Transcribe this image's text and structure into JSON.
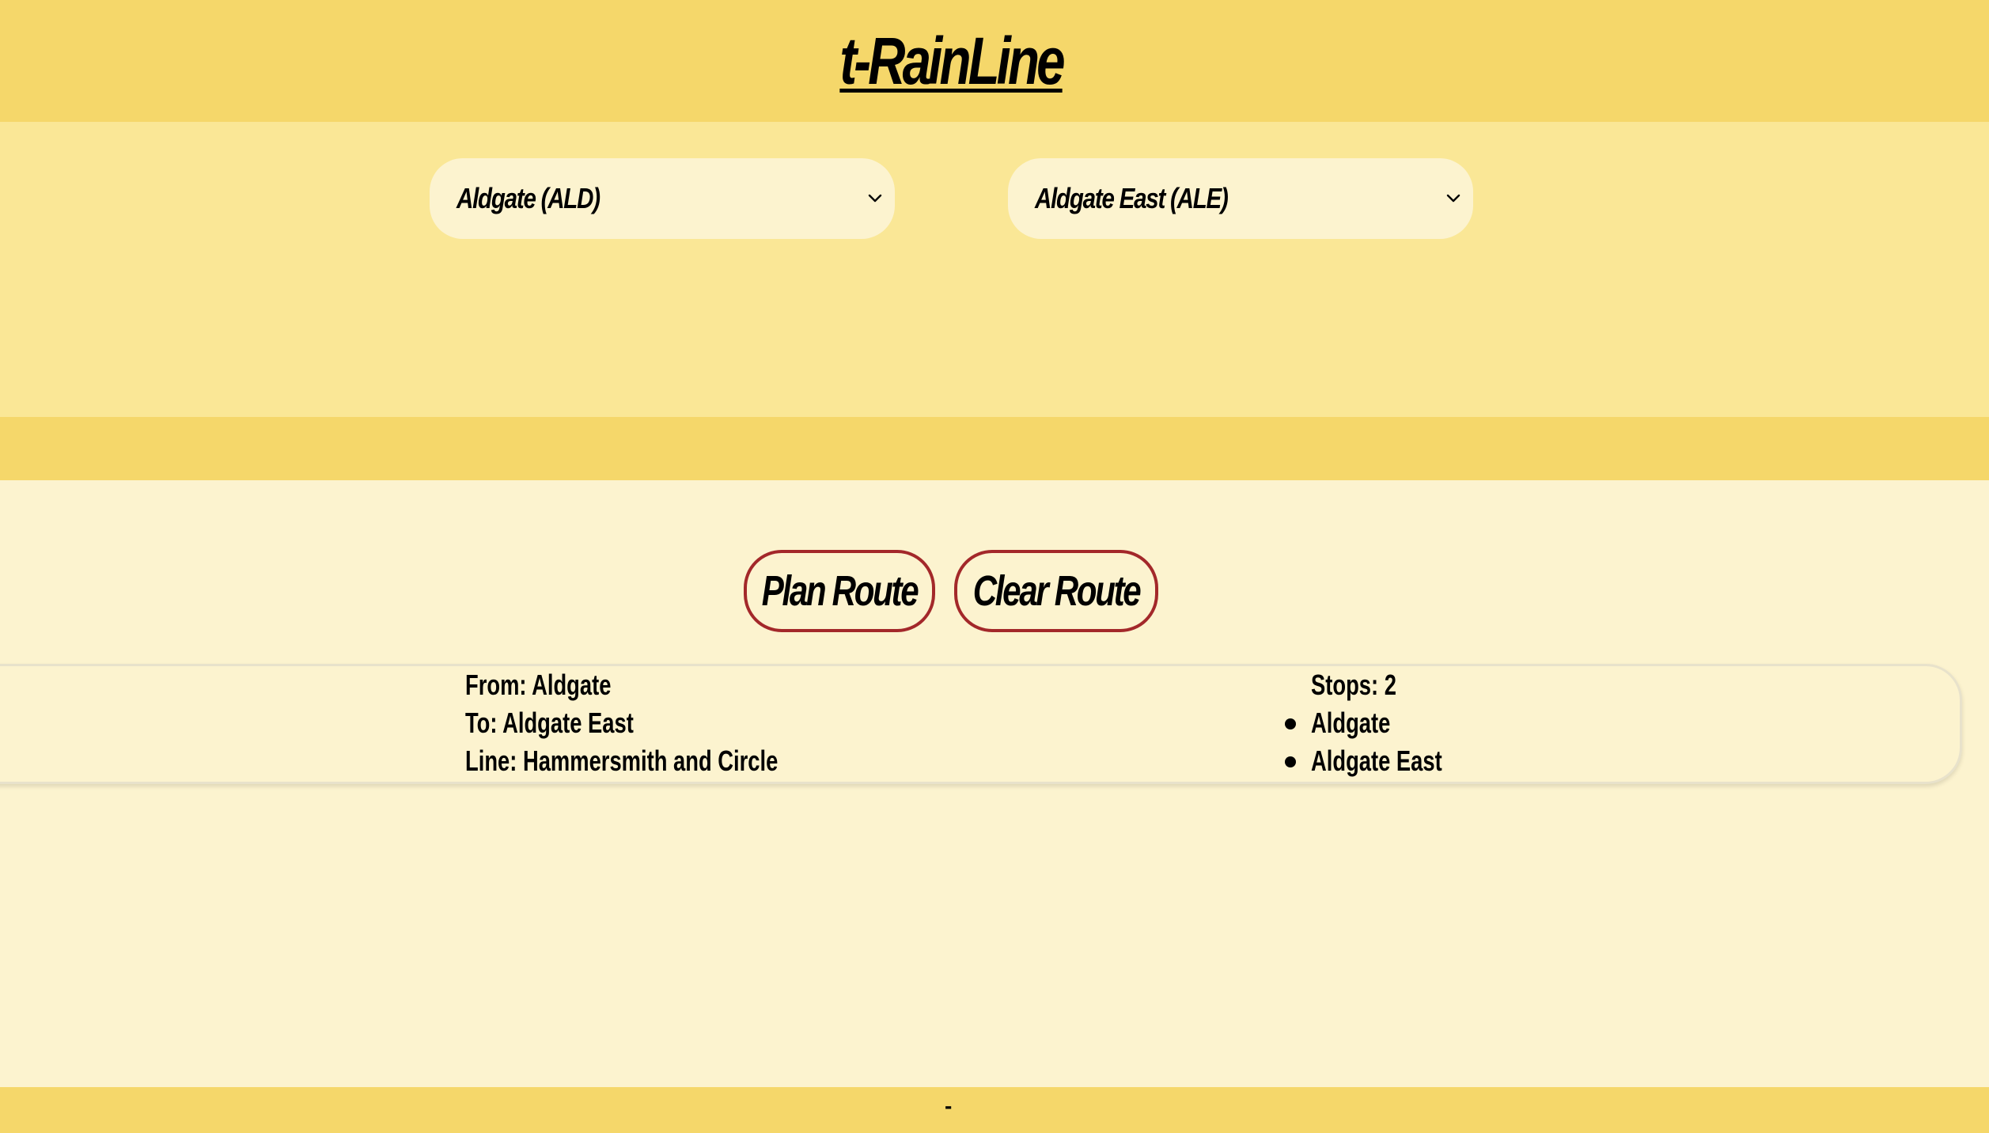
{
  "app": {
    "title": "t-RainLine"
  },
  "selects": {
    "from_value": "Aldgate (ALD)",
    "to_value": "Aldgate East (ALE)"
  },
  "buttons": {
    "plan_label": "Plan Route",
    "clear_label": "Clear Route"
  },
  "result": {
    "from": "From: Aldgate",
    "to": "To: Aldgate East",
    "line": "Line: Hammersmith and Circle",
    "stops": "Stops: 2",
    "stop_list": [
      "Aldgate",
      "Aldgate East"
    ]
  },
  "footer": {
    "text": "-"
  },
  "colors": {
    "header": "#f5d76a",
    "select_band": "#fae796",
    "page_bg": "#fcf3cf",
    "button_border": "#a3282a"
  },
  "icons": {
    "select_arrow": "chevron-down-icon"
  }
}
